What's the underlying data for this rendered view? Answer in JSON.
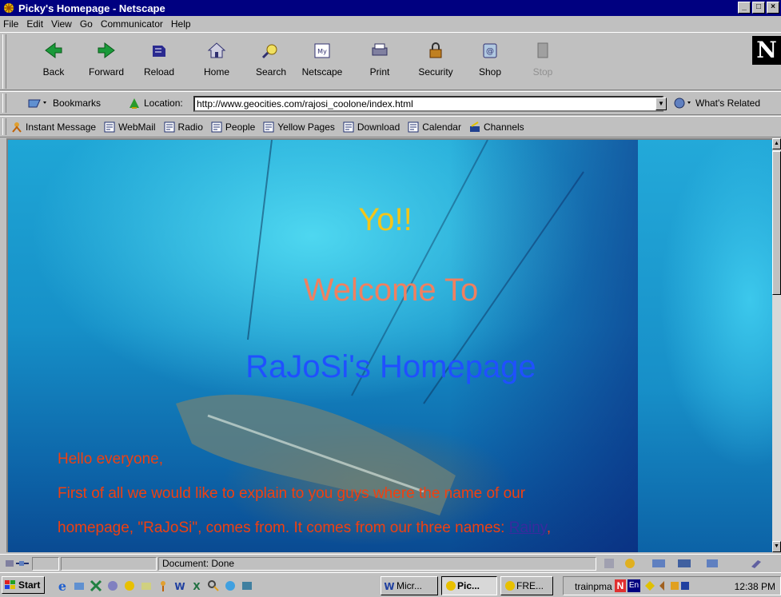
{
  "window": {
    "title": "Picky's Homepage - Netscape",
    "controls": [
      "_",
      "□",
      "×"
    ]
  },
  "menu": [
    {
      "label": "File",
      "mnemonic": "F"
    },
    {
      "label": "Edit",
      "mnemonic": "E"
    },
    {
      "label": "View",
      "mnemonic": "V"
    },
    {
      "label": "Go",
      "mnemonic": "G"
    },
    {
      "label": "Communicator",
      "mnemonic": "C"
    },
    {
      "label": "Help",
      "mnemonic": "H"
    }
  ],
  "toolbar": {
    "back": "Back",
    "forward": "Forward",
    "reload": "Reload",
    "home": "Home",
    "search": "Search",
    "netscape": "Netscape",
    "print": "Print",
    "security": "Security",
    "shop": "Shop",
    "stop": "Stop",
    "logo": "N"
  },
  "location": {
    "bookmarks": "Bookmarks",
    "label": "Location:",
    "url": "http://www.geocities.com/rajosi_coolone/index.html",
    "whats_related": "What's Related"
  },
  "personal": [
    "Instant Message",
    "WebMail",
    "Radio",
    "People",
    "Yellow Pages",
    "Download",
    "Calendar",
    "Channels"
  ],
  "page": {
    "line1": "Yo!!",
    "line2": "Welcome To",
    "line3": "RaJoSi's Homepage",
    "greeting": "Hello everyone,",
    "para1": "First of all we would like to explain to you guys where the name of our",
    "para2_pre": "homepage, \"RaJoSi\", comes from. It comes from our three names: ",
    "para2_link": "Rainy",
    "para2_post": ",",
    "colors": {
      "yo": "#f5c518",
      "welcome": "#f08060",
      "rajosi": "#2050ff",
      "body": "#f04010",
      "link": "#3a2a9e"
    }
  },
  "status": {
    "text": "Document: Done"
  },
  "taskbar": {
    "start": "Start",
    "tasks": [
      "Micr...",
      "Pic...",
      "FRE...",
      "trainpma"
    ],
    "tray_lang": "En",
    "clock": "12:38 PM"
  }
}
